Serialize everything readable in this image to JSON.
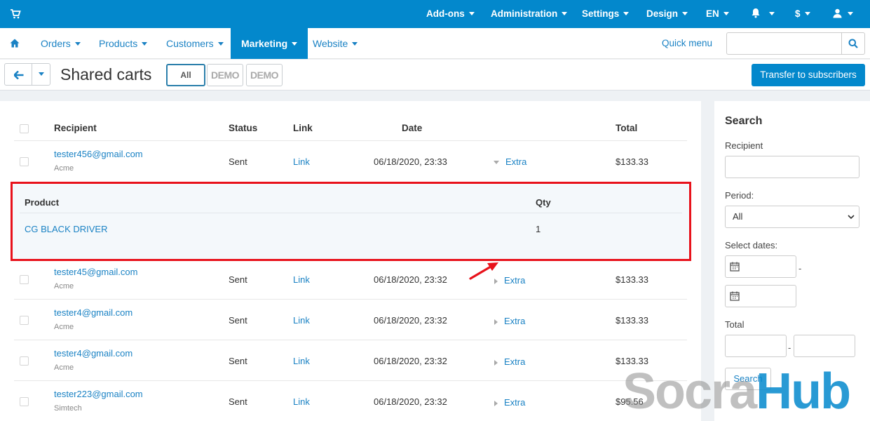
{
  "topbar": {
    "items": [
      {
        "label": "Add-ons"
      },
      {
        "label": "Administration"
      },
      {
        "label": "Settings"
      },
      {
        "label": "Design"
      },
      {
        "label": "EN"
      }
    ],
    "currency": "$"
  },
  "mainnav": {
    "items": [
      {
        "label": "Orders"
      },
      {
        "label": "Products"
      },
      {
        "label": "Customers"
      },
      {
        "label": "Marketing"
      },
      {
        "label": "Website"
      }
    ],
    "quick_menu": "Quick menu",
    "search_placeholder": ""
  },
  "titlebar": {
    "title": "Shared carts",
    "tabs": [
      {
        "label": "All"
      },
      {
        "label": "DEMO"
      },
      {
        "label": "DEMO"
      }
    ],
    "transfer_label": "Transfer to subscribers"
  },
  "table": {
    "headers": {
      "recipient": "Recipient",
      "status": "Status",
      "link": "Link",
      "date": "Date",
      "total": "Total"
    },
    "rows": [
      {
        "email": "tester456@gmail.com",
        "company": "Acme",
        "status": "Sent",
        "link": "Link",
        "date": "06/18/2020, 23:33",
        "extra": "Extra",
        "total": "$133.33"
      },
      {
        "email": "tester45@gmail.com",
        "company": "Acme",
        "status": "Sent",
        "link": "Link",
        "date": "06/18/2020, 23:32",
        "extra": "Extra",
        "total": "$133.33"
      },
      {
        "email": "tester4@gmail.com",
        "company": "Acme",
        "status": "Sent",
        "link": "Link",
        "date": "06/18/2020, 23:32",
        "extra": "Extra",
        "total": "$133.33"
      },
      {
        "email": "tester4@gmail.com",
        "company": "Acme",
        "status": "Sent",
        "link": "Link",
        "date": "06/18/2020, 23:32",
        "extra": "Extra",
        "total": "$133.33"
      },
      {
        "email": "tester223@gmail.com",
        "company": "Simtech",
        "status": "Sent",
        "link": "Link",
        "date": "06/18/2020, 23:32",
        "extra": "Extra",
        "total": "$95.56"
      }
    ],
    "extra": {
      "headers": {
        "product": "Product",
        "qty": "Qty"
      },
      "items": [
        {
          "product": "CG BLACK DRIVER",
          "qty": "1"
        }
      ]
    }
  },
  "sidebar": {
    "title": "Search",
    "recipient_label": "Recipient",
    "period_label": "Period:",
    "period_value": "All",
    "select_dates_label": "Select dates:",
    "total_label": "Total",
    "dash": "-",
    "search_button": "Search"
  },
  "watermark": {
    "part1": "Socra",
    "part2": "Hub"
  },
  "colors": {
    "primary": "#0388cc",
    "link": "#1a82c4",
    "highlight": "#e8121b"
  }
}
